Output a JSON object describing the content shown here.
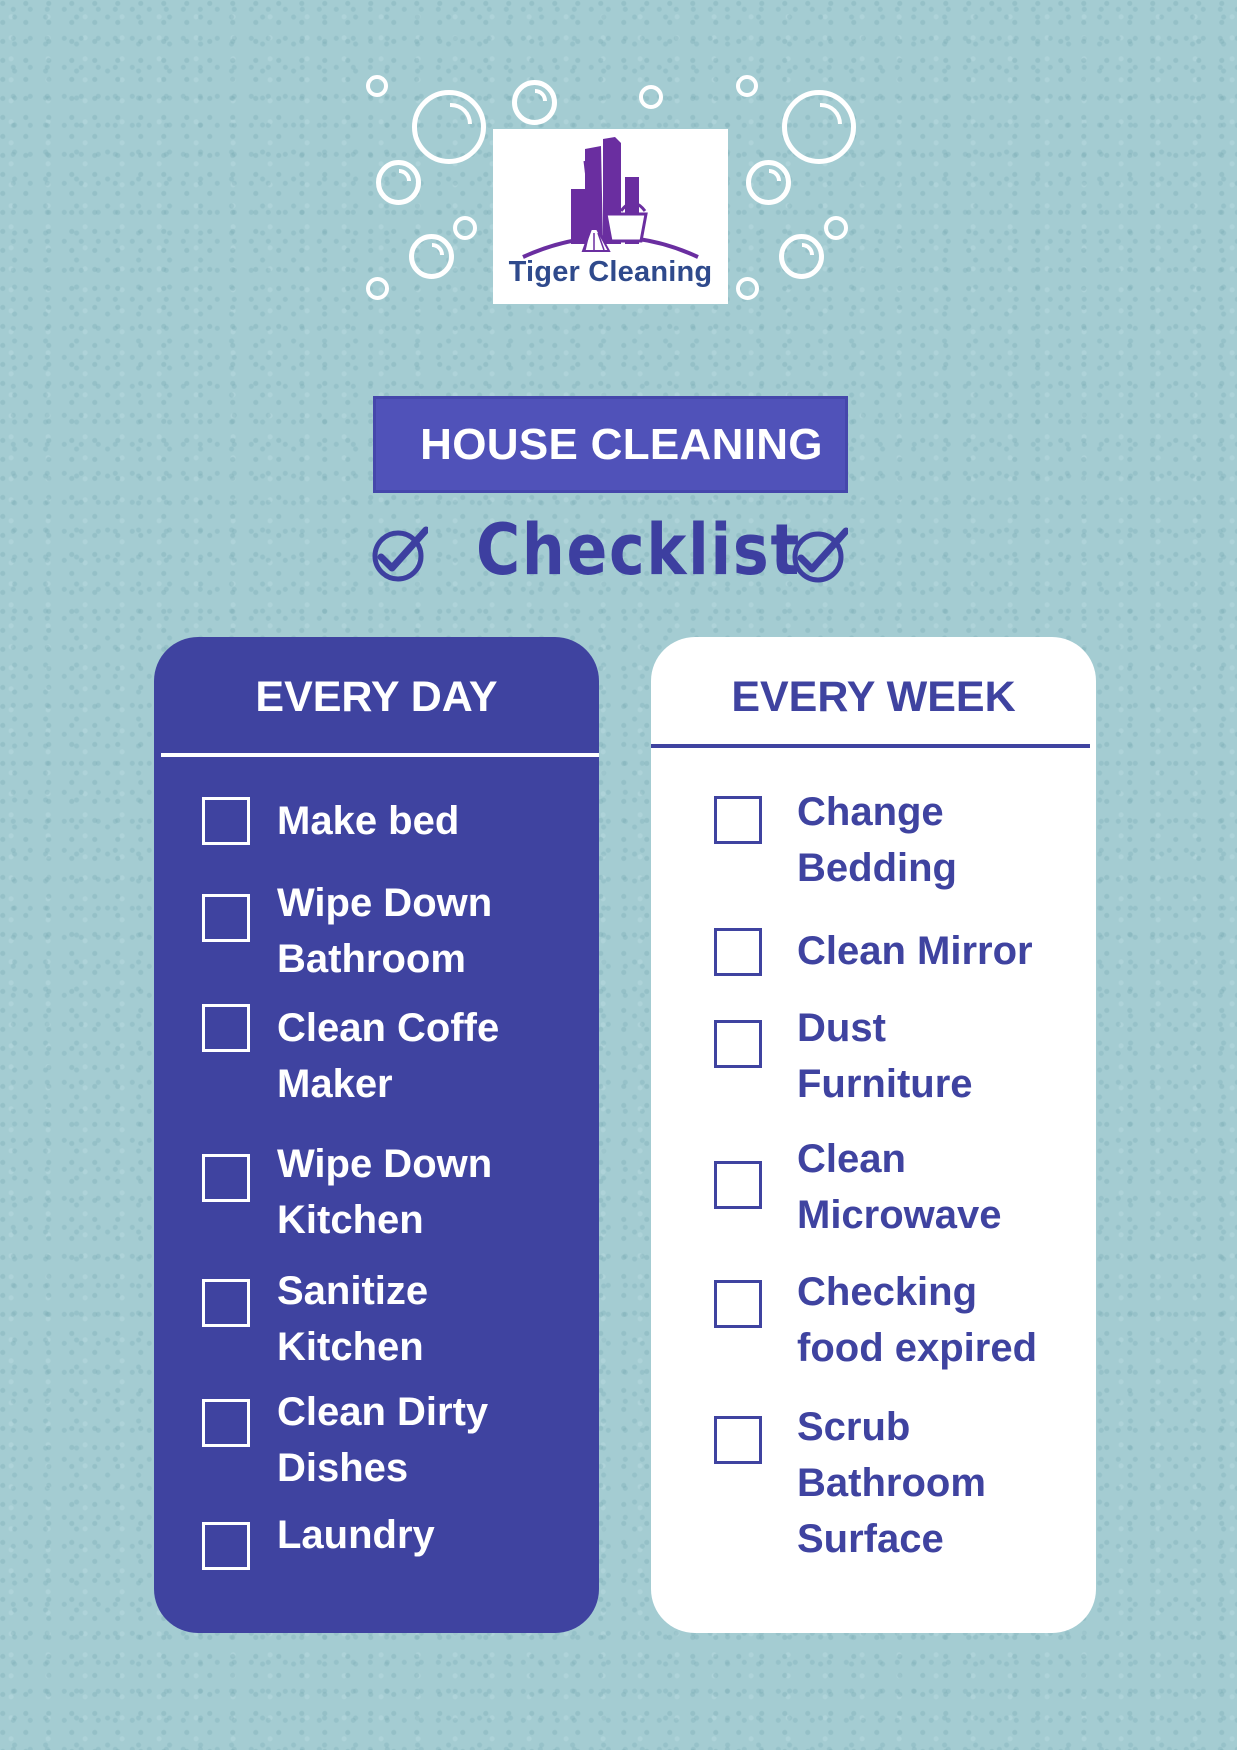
{
  "logo": {
    "brand_name": "Tiger Cleaning",
    "colors": {
      "buildings": "#6a2ea0",
      "text": "#2f4a8c"
    }
  },
  "header": {
    "title": "HOUSE CLEANING",
    "subtitle": "Checklist",
    "left_icon": "check-circle-icon",
    "right_icon": "check-circle-icon"
  },
  "colors": {
    "background": "#a4ccd2",
    "accent": "#3f43a0",
    "banner": "#5052b9",
    "white": "#ffffff"
  },
  "every_day": {
    "heading": "EVERY DAY",
    "items": [
      {
        "label": "Make bed",
        "checked": false
      },
      {
        "label": "Wipe Down\nBathroom",
        "checked": false
      },
      {
        "label": "Clean Coffe\nMaker",
        "checked": false
      },
      {
        "label": "Wipe Down\nKitchen",
        "checked": false
      },
      {
        "label": "Sanitize\nKitchen",
        "checked": false
      },
      {
        "label": "Clean Dirty\nDishes",
        "checked": false
      },
      {
        "label": "Laundry",
        "checked": false
      }
    ]
  },
  "every_week": {
    "heading": "EVERY WEEK",
    "items": [
      {
        "label": "Change\nBedding",
        "checked": false
      },
      {
        "label": "Clean Mirror",
        "checked": false
      },
      {
        "label": "Dust\nFurniture",
        "checked": false
      },
      {
        "label": "Clean\nMicrowave",
        "checked": false
      },
      {
        "label": "Checking\nfood expired",
        "checked": false
      },
      {
        "label": "Scrub\nBathroom\nSurface",
        "checked": false
      }
    ]
  }
}
